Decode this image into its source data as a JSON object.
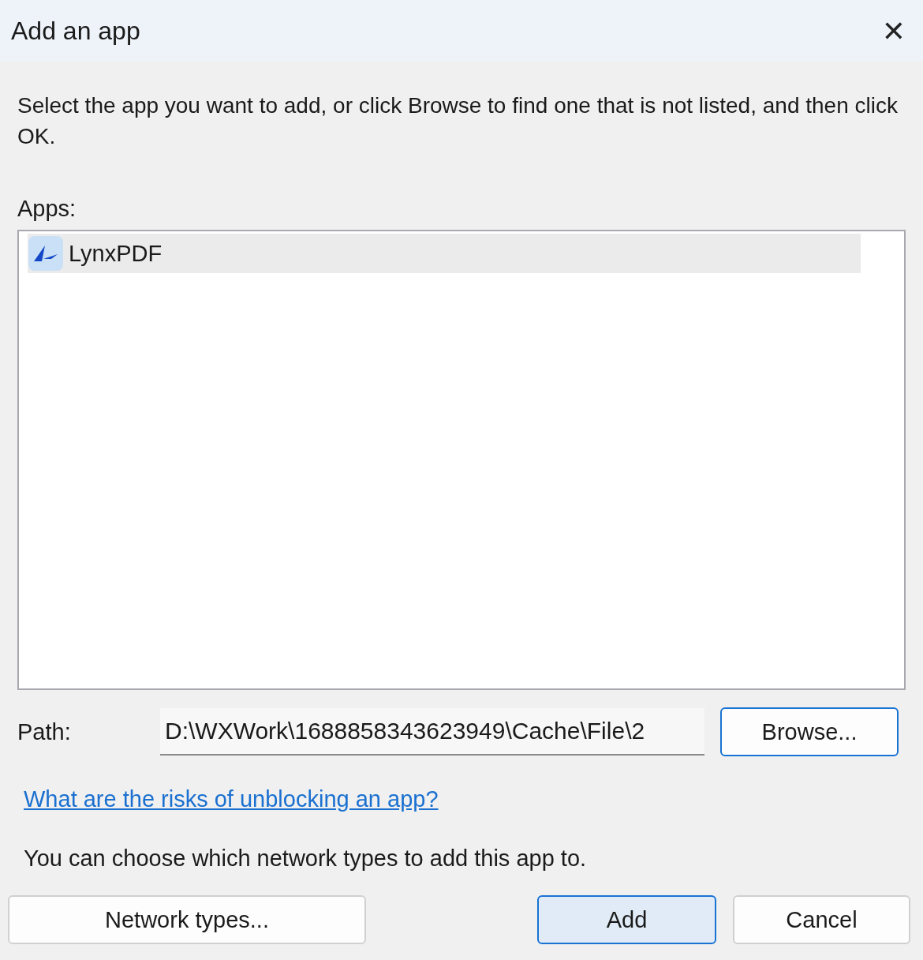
{
  "window": {
    "title": "Add an app",
    "close": "✕"
  },
  "instructions": "Select the app you want to add, or click Browse to find one that is not listed, and then click OK.",
  "apps": {
    "label": "Apps:",
    "items": [
      {
        "name": "LynxPDF",
        "selected": true
      }
    ]
  },
  "path": {
    "label": "Path:",
    "value": "D:\\WXWork\\1688858343623949\\Cache\\File\\2"
  },
  "browse": {
    "label": "Browse...",
    "kind": "focused"
  },
  "link": "What are the risks of unblocking an app?",
  "network_note": "You can choose which network types to add this app to.",
  "buttons": [
    {
      "label": "Network types...",
      "kind": "normal"
    },
    {
      "label": "Add",
      "kind": "default"
    },
    {
      "label": "Cancel",
      "kind": "normal"
    }
  ]
}
